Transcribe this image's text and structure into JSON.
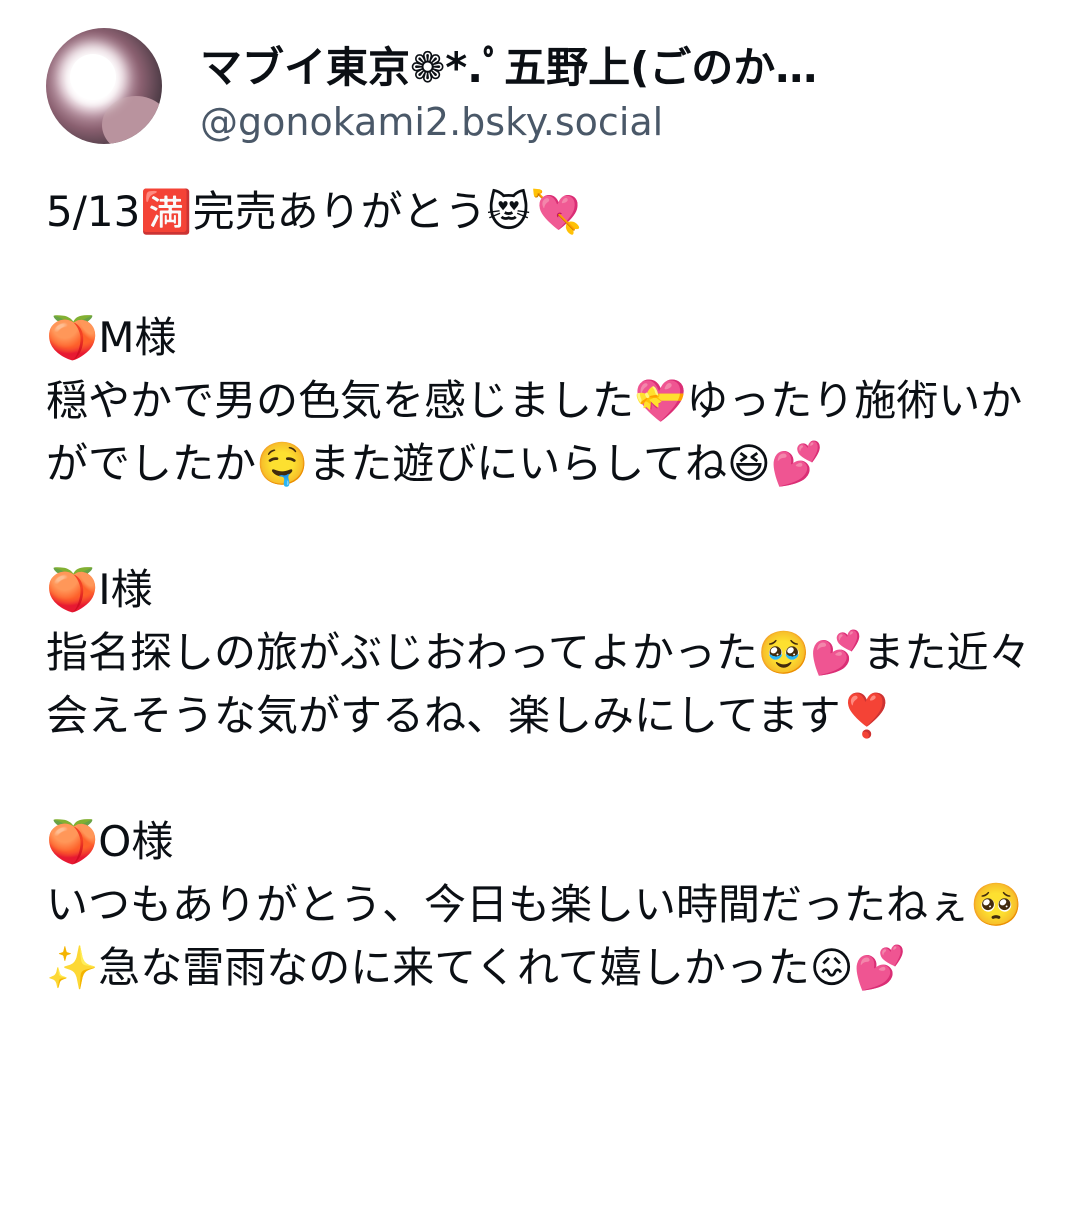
{
  "author": {
    "display_name": "マブイ東京❁*.ﾟ五野上(ごのか…",
    "handle": "@gonokami2.bsky.social"
  },
  "post": {
    "text": "5/13🈵完売ありがとう😻💘\n\n🍑M様\n穏やかで男の色気を感じました💝ゆったり施術いかがでしたか🤤また遊びにいらしてね😆💕\n\n🍑I様\n指名探しの旅がぶじおわってよかった🥹💕また近々会えそうな気がするね、楽しみにしてます❣️\n\n🍑O様\nいつもありがとう、今日も楽しい時間だったねぇ🥺✨急な雷雨なのに来てくれて嬉しかった😖💕"
  }
}
